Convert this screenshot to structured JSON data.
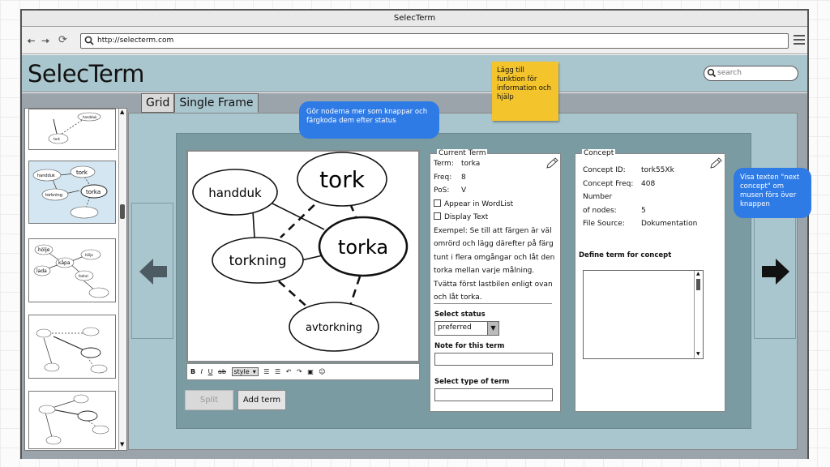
{
  "window": {
    "title": "SelecTerm"
  },
  "addressbar": {
    "url": "http://selecterm.com"
  },
  "app": {
    "logo": "SelecTerm",
    "search_placeholder": "search"
  },
  "tabs": [
    {
      "label": "Grid"
    },
    {
      "label": "Single Frame"
    }
  ],
  "diagram": {
    "nodes": [
      "handduk",
      "tork",
      "torkning",
      "torka",
      "avtorkning"
    ]
  },
  "thumbnail_words": {
    "t1": [
      "tork",
      "torka",
      "handduk"
    ],
    "t2": [
      "handduk",
      "tork",
      "torka",
      "torkning"
    ],
    "t3": [
      "hölje",
      "kåpa",
      "lada",
      "hölja",
      "fodral"
    ]
  },
  "editor_toolbar": {
    "bold": "B",
    "italic": "I",
    "underline": "U",
    "strike": "ab",
    "style": "style"
  },
  "buttons": {
    "split": "Split",
    "add_term": "Add term"
  },
  "current_term": {
    "legend": "Current Term",
    "term_label": "Term:",
    "term_value": "torka",
    "freq_label": "Freq:",
    "freq_value": "8",
    "pos_label": "PoS:",
    "pos_value": "V",
    "appear_wordlist": "Appear in WordList",
    "display_text": "Display Text",
    "example_lines": [
      "Exempel: Se till att färgen är väl",
      "omrörd och lägg därefter på färg",
      "tunt i flera omgångar och låt den",
      "torka mellan varje målning.",
      "Tvätta först lastbilen enligt ovan",
      "och låt torka."
    ],
    "select_status_label": "Select status",
    "status_value": "preferred",
    "note_label": "Note for this term",
    "type_label": "Select type of term"
  },
  "concept": {
    "legend": "Concept",
    "id_label": "Concept ID:",
    "id_value": "tork55Xk",
    "freq_label": "Concept Freq:",
    "freq_value": "408",
    "nodes_label_1": "Number",
    "nodes_label_2": "of nodes:",
    "nodes_value": "5",
    "source_label": "File Source:",
    "source_value": "Dokumentation",
    "define_label": "Define term for concept"
  },
  "annotations": {
    "bubble_top": [
      "Gör noderna mer som knappar och",
      "färgkoda dem efter status"
    ],
    "sticky": [
      "Lägg till",
      "funktion för",
      "information och",
      "hjälp"
    ],
    "bubble_right": [
      "Visa texten \"next",
      "concept\" om",
      "musen förs över",
      "knappen"
    ]
  },
  "colors": {
    "header_bg": "#a9c5cd",
    "content_bg": "#9aa4aa",
    "frame_bg": "#7b9ba2",
    "bubble": "#2f7be6",
    "sticky": "#f3c42c"
  }
}
